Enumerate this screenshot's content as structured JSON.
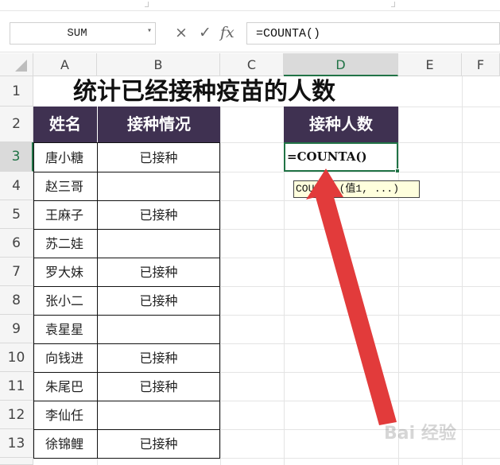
{
  "formula_bar": {
    "name_box": "SUM",
    "cancel_icon": "×",
    "enter_icon": "✓",
    "fx_icon": "fx",
    "formula": "=COUNTA()"
  },
  "columns": [
    "A",
    "B",
    "C",
    "D",
    "E",
    "F"
  ],
  "selected_column": "D",
  "rows": [
    "1",
    "2",
    "3",
    "4",
    "5",
    "6",
    "7",
    "8",
    "9",
    "10",
    "11",
    "12",
    "13"
  ],
  "selected_row": "3",
  "sheet": {
    "title": "统计已经接种疫苗的人数",
    "table_headers": [
      "姓名",
      "接种情况"
    ],
    "people": [
      {
        "name": "唐小糖",
        "status": "已接种"
      },
      {
        "name": "赵三哥",
        "status": ""
      },
      {
        "name": "王麻子",
        "status": "已接种"
      },
      {
        "name": "苏二娃",
        "status": ""
      },
      {
        "name": "罗大妹",
        "status": "已接种"
      },
      {
        "name": "张小二",
        "status": "已接种"
      },
      {
        "name": "袁星星",
        "status": ""
      },
      {
        "name": "向钱进",
        "status": "已接种"
      },
      {
        "name": "朱尾巴",
        "status": "已接种"
      },
      {
        "name": "李仙任",
        "status": ""
      },
      {
        "name": "徐锦鲤",
        "status": "已接种"
      }
    ],
    "count_header": "接种人数",
    "active_cell_text": "=COUNTA()",
    "tooltip": "COUNTA (值1, ...)"
  },
  "watermark": "Bai 经验",
  "colors": {
    "header_fill": "#3f3151",
    "selection_green": "#217346",
    "arrow_red": "#e23b3b",
    "tooltip_fill": "#ffffdd"
  }
}
